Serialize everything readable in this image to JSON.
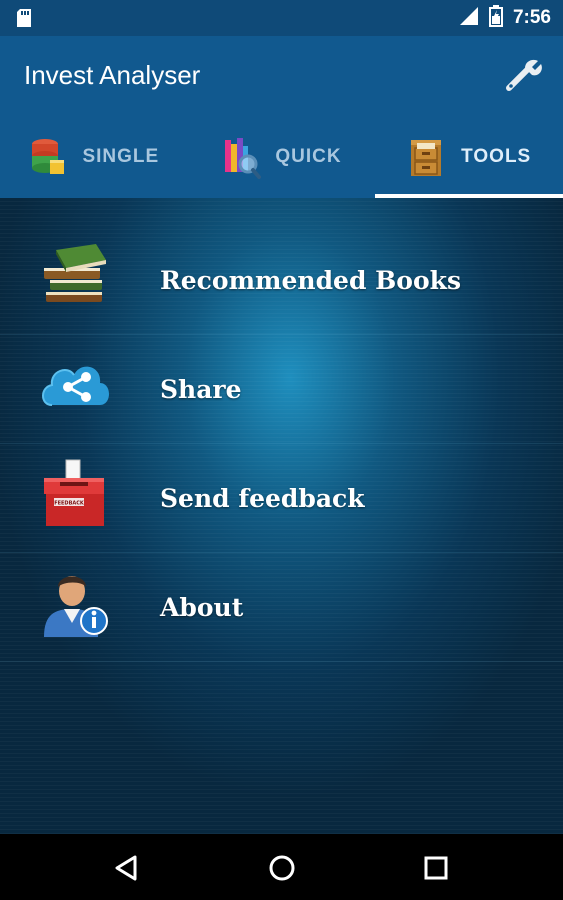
{
  "status_bar": {
    "time": "7:56",
    "icons": [
      "sd-card-icon",
      "signal-icon",
      "battery-icon"
    ]
  },
  "app_bar": {
    "title": "Invest Analyser",
    "action_icon": "wrench-icon"
  },
  "tabs": [
    {
      "label": "SINGLE",
      "icon": "database-icon",
      "active": false
    },
    {
      "label": "QUICK",
      "icon": "books-search-icon",
      "active": false
    },
    {
      "label": "TOOLS",
      "icon": "cabinet-icon",
      "active": true
    }
  ],
  "menu": [
    {
      "label": "Recommended Books",
      "icon": "books-icon"
    },
    {
      "label": "Share",
      "icon": "share-cloud-icon"
    },
    {
      "label": "Send feedback",
      "icon": "feedback-box-icon"
    },
    {
      "label": "About",
      "icon": "user-info-icon"
    }
  ],
  "nav_bar": {
    "buttons": [
      "back-icon",
      "home-icon",
      "recents-icon"
    ]
  },
  "colors": {
    "status_bar": "#0f4a78",
    "app_bar": "#11598f",
    "content_center": "#2096c8",
    "content_edge": "#08283f"
  }
}
